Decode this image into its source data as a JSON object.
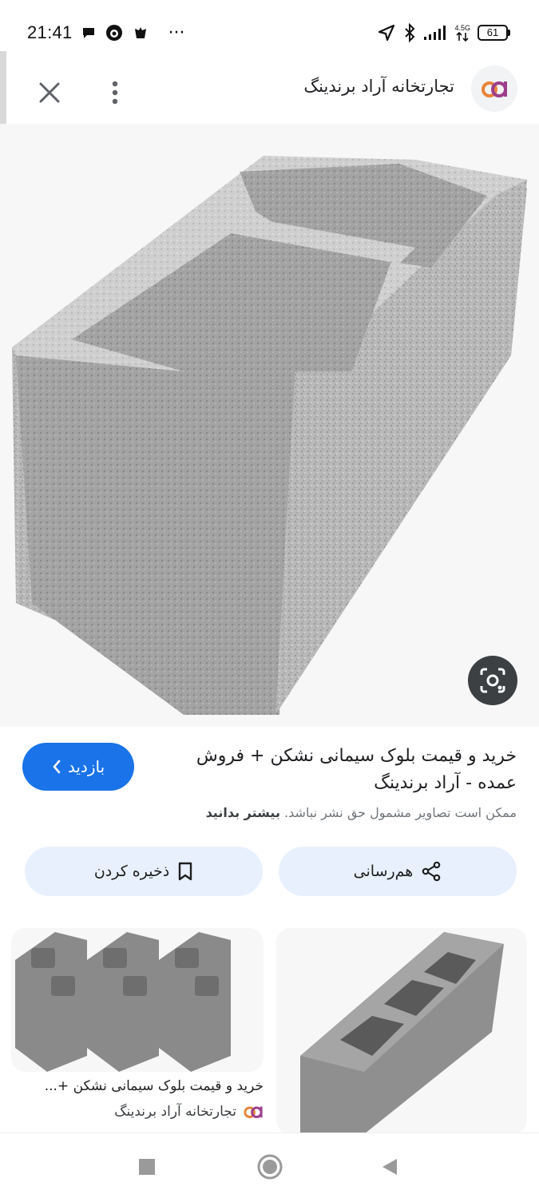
{
  "status_bar": {
    "time": "21:41",
    "more": "···",
    "network": "4.5G",
    "battery": "61",
    "icons": [
      "chat-bubble-icon",
      "notification-app-icon",
      "notification-app-icon",
      "location-arrow-icon",
      "bluetooth-icon",
      "signal-icon",
      "data-arrows-icon",
      "battery-icon"
    ]
  },
  "top_bar": {
    "source_title": "تجارتخانه آراد برندینگ",
    "close_icon": "close-icon",
    "more_icon": "more-vertical-icon",
    "logo_icon": "site-logo-icon"
  },
  "result": {
    "title": "خرید و قیمت بلوک سیمانی نشکن + فروش عمده - آراد برندینگ",
    "visit_label": "بازدید",
    "copyright_text": "ممکن است تصاویر مشمول حق نشر نباشد.",
    "learn_more": "بیشتر بدانید"
  },
  "actions": {
    "share_label": "هم‌رسانی",
    "save_label": "ذخیره کردن"
  },
  "related": {
    "card_title": "خرید و قیمت بلوک سیمانی نشکن +...",
    "card_source": "تجارتخانه آراد برندینگ"
  },
  "colors": {
    "accent": "#1a73e8",
    "chip_bg": "#e8f0fe",
    "lens_bg": "#3c4043",
    "logo_orange": "#e8833a",
    "logo_purple": "#9c3f8c"
  }
}
